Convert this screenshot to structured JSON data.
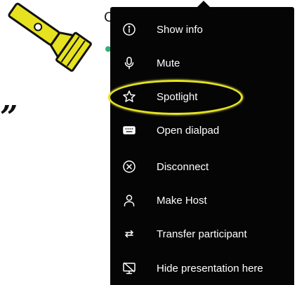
{
  "background": {
    "partial_letter": "C",
    "quote_mark": "”"
  },
  "menu": {
    "items": [
      {
        "label": "Show info",
        "icon": "info-icon"
      },
      {
        "label": "Mute",
        "icon": "microphone-icon"
      },
      {
        "label": "Spotlight",
        "icon": "star-icon",
        "highlighted": true
      },
      {
        "label": "Open dialpad",
        "icon": "keyboard-icon"
      },
      {
        "label": "Disconnect",
        "icon": "close-circle-icon"
      },
      {
        "label": "Make Host",
        "icon": "person-icon"
      },
      {
        "label": "Transfer participant",
        "icon": "transfer-arrows-icon"
      },
      {
        "label": "Hide presentation here",
        "icon": "screen-off-icon"
      }
    ]
  },
  "colors": {
    "menu_background": "#050505",
    "menu_text": "#ffffff",
    "annotation_yellow": "#e6e21f",
    "status_green": "#2db37a"
  }
}
